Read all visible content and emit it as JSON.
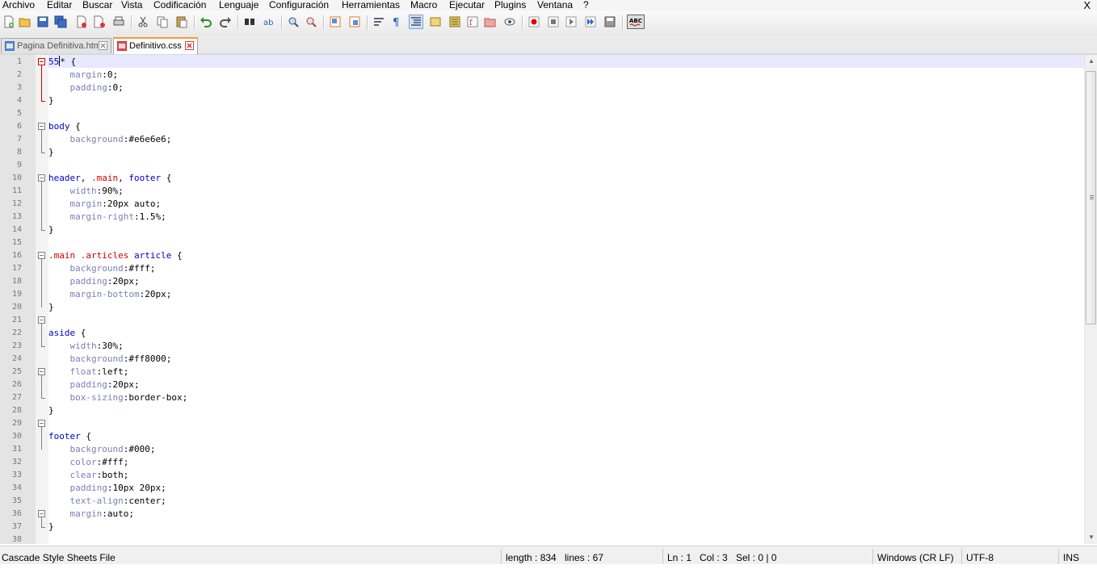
{
  "menubar": {
    "items": [
      "Archivo",
      "Editar",
      "Buscar",
      "Vista",
      "Codificación",
      "Lenguaje",
      "Configuración",
      "Herramientas",
      "Macro",
      "Ejecutar",
      "Plugins",
      "Ventana",
      "?"
    ],
    "close": "X"
  },
  "tabs": [
    {
      "label": "Pagina Definitiva.html",
      "active": false
    },
    {
      "label": "Definitivo.css",
      "active": true
    }
  ],
  "editor": {
    "current_line": 1,
    "lines": [
      [
        {
          "t": "55",
          "c": "selector"
        },
        {
          "t": "caret",
          "c": "caret"
        },
        {
          "t": "* {",
          "c": "punct"
        }
      ],
      [
        {
          "t": "    ",
          "c": "punct"
        },
        {
          "t": "margin",
          "c": "prop"
        },
        {
          "t": ":0;",
          "c": "value"
        }
      ],
      [
        {
          "t": "    ",
          "c": "punct"
        },
        {
          "t": "padding",
          "c": "prop"
        },
        {
          "t": ":0;",
          "c": "value"
        }
      ],
      [
        {
          "t": "}",
          "c": "punct"
        }
      ],
      [],
      [
        {
          "t": "body",
          "c": "selector"
        },
        {
          "t": " {",
          "c": "punct"
        }
      ],
      [
        {
          "t": "    ",
          "c": "punct"
        },
        {
          "t": "background",
          "c": "prop"
        },
        {
          "t": ":#e6e6e6;",
          "c": "value"
        }
      ],
      [
        {
          "t": "}",
          "c": "punct"
        }
      ],
      [],
      [
        {
          "t": "header",
          "c": "selector"
        },
        {
          "t": ", ",
          "c": "punct"
        },
        {
          "t": ".main",
          "c": "class"
        },
        {
          "t": ", ",
          "c": "punct"
        },
        {
          "t": "footer",
          "c": "selector"
        },
        {
          "t": " {",
          "c": "punct"
        }
      ],
      [
        {
          "t": "    ",
          "c": "punct"
        },
        {
          "t": "width",
          "c": "prop"
        },
        {
          "t": ":90%;",
          "c": "value"
        }
      ],
      [
        {
          "t": "    ",
          "c": "punct"
        },
        {
          "t": "margin",
          "c": "prop"
        },
        {
          "t": ":20px auto;",
          "c": "value"
        }
      ],
      [
        {
          "t": "    ",
          "c": "punct"
        },
        {
          "t": "margin-right",
          "c": "prop"
        },
        {
          "t": ":1.5%;",
          "c": "value"
        }
      ],
      [
        {
          "t": "}",
          "c": "punct"
        }
      ],
      [],
      [
        {
          "t": ".main",
          "c": "class"
        },
        {
          "t": " ",
          "c": "punct"
        },
        {
          "t": ".articles",
          "c": "class"
        },
        {
          "t": " ",
          "c": "punct"
        },
        {
          "t": "article",
          "c": "selector"
        },
        {
          "t": " {",
          "c": "punct"
        }
      ],
      [
        {
          "t": "    ",
          "c": "punct"
        },
        {
          "t": "background",
          "c": "prop"
        },
        {
          "t": ":#fff;",
          "c": "value"
        }
      ],
      [
        {
          "t": "    ",
          "c": "punct"
        },
        {
          "t": "padding",
          "c": "prop"
        },
        {
          "t": ":20px;",
          "c": "value"
        }
      ],
      [
        {
          "t": "    ",
          "c": "punct"
        },
        {
          "t": "margin-bottom",
          "c": "prop"
        },
        {
          "t": ":20px;",
          "c": "value"
        }
      ],
      [
        {
          "t": "}",
          "c": "punct"
        }
      ],
      [],
      [
        {
          "t": "aside",
          "c": "selector"
        },
        {
          "t": " {",
          "c": "punct"
        }
      ],
      [
        {
          "t": "    ",
          "c": "punct"
        },
        {
          "t": "width",
          "c": "prop"
        },
        {
          "t": ":30%;",
          "c": "value"
        }
      ],
      [
        {
          "t": "    ",
          "c": "punct"
        },
        {
          "t": "background",
          "c": "prop"
        },
        {
          "t": ":#ff8000;",
          "c": "value"
        }
      ],
      [
        {
          "t": "    ",
          "c": "punct"
        },
        {
          "t": "float",
          "c": "prop"
        },
        {
          "t": ":left;",
          "c": "value"
        }
      ],
      [
        {
          "t": "    ",
          "c": "punct"
        },
        {
          "t": "padding",
          "c": "prop"
        },
        {
          "t": ":20px;",
          "c": "value"
        }
      ],
      [
        {
          "t": "    ",
          "c": "punct"
        },
        {
          "t": "box-sizing",
          "c": "prop"
        },
        {
          "t": ":border-box;",
          "c": "value"
        }
      ],
      [
        {
          "t": "}",
          "c": "punct"
        }
      ],
      [],
      [
        {
          "t": "footer",
          "c": "selector"
        },
        {
          "t": " {",
          "c": "punct"
        }
      ],
      [
        {
          "t": "    ",
          "c": "punct"
        },
        {
          "t": "background",
          "c": "prop"
        },
        {
          "t": ":#000;",
          "c": "value"
        }
      ],
      [
        {
          "t": "    ",
          "c": "punct"
        },
        {
          "t": "color",
          "c": "prop"
        },
        {
          "t": ":#fff;",
          "c": "value"
        }
      ],
      [
        {
          "t": "    ",
          "c": "punct"
        },
        {
          "t": "clear",
          "c": "prop"
        },
        {
          "t": ":both;",
          "c": "value"
        }
      ],
      [
        {
          "t": "    ",
          "c": "punct"
        },
        {
          "t": "padding",
          "c": "prop"
        },
        {
          "t": ":10px 20px;",
          "c": "value"
        }
      ],
      [
        {
          "t": "    ",
          "c": "punct"
        },
        {
          "t": "text-align",
          "c": "prop"
        },
        {
          "t": ":center;",
          "c": "value"
        }
      ],
      [
        {
          "t": "    ",
          "c": "punct"
        },
        {
          "t": "margin",
          "c": "prop"
        },
        {
          "t": ":auto;",
          "c": "value"
        }
      ],
      [
        {
          "t": "}",
          "c": "punct"
        }
      ],
      []
    ]
  },
  "statusbar": {
    "file_type": "Cascade Style Sheets File",
    "length": "length : 834",
    "lines": "lines : 67",
    "ln": "Ln : 1",
    "col": "Col : 3",
    "sel": "Sel : 0 | 0",
    "eol": "Windows (CR LF)",
    "encoding": "UTF-8",
    "mode": "INS"
  },
  "colors": {
    "selector": "#0000c8",
    "class": "#d00000",
    "property": "#7e7eb8",
    "active_tab_accent": "#f59a3a",
    "current_line": "#e8e8ff"
  }
}
